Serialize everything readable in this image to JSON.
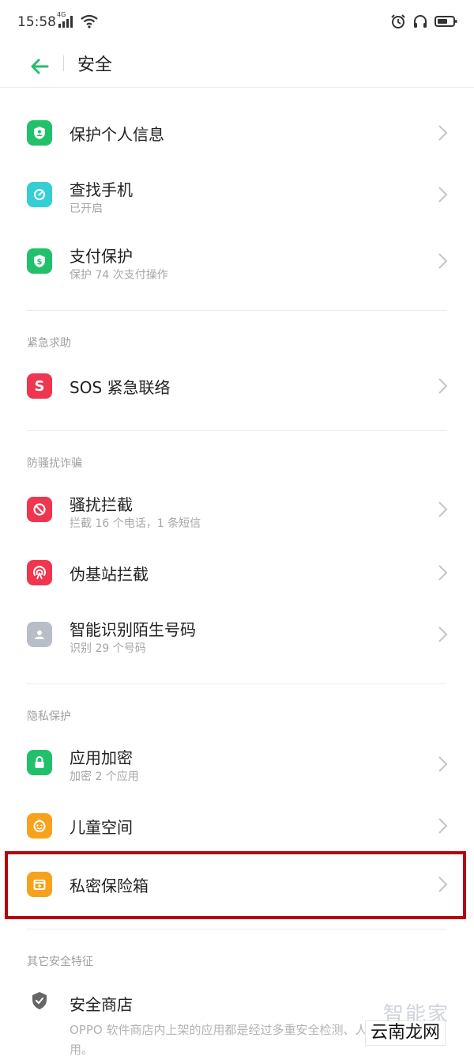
{
  "status_bar": {
    "time": "15:58",
    "network_label": "4G",
    "icons": [
      "signal-icon",
      "wifi-icon",
      "alarm-icon",
      "headset-icon",
      "battery-icon"
    ]
  },
  "nav": {
    "title": "安全",
    "back_icon": "back-arrow-icon"
  },
  "colors": {
    "accent_green": "#21c16b",
    "cyan": "#33cfd4",
    "red": "#f0354e",
    "grey": "#b7bec8",
    "orange": "#f7a21c",
    "highlight_red": "#b3050d"
  },
  "items": {
    "protect_info": {
      "title": "保护个人信息"
    },
    "find_phone": {
      "title": "查找手机",
      "subtitle": "已开启"
    },
    "payment": {
      "title": "支付保护",
      "subtitle": "保护 74 次支付操作"
    },
    "sos": {
      "title": "SOS 紧急联络",
      "icon_letter": "S"
    },
    "harass": {
      "title": "骚扰拦截",
      "subtitle": "拦截 16 个电话，1 条短信"
    },
    "pseudo_station": {
      "title": "伪基站拦截"
    },
    "identify": {
      "title": "智能识别陌生号码",
      "subtitle": "识别 29 个号码"
    },
    "app_lock": {
      "title": "应用加密",
      "subtitle": "加密 2 个应用"
    },
    "kids_space": {
      "title": "儿童空间"
    },
    "private_safe": {
      "title": "私密保险箱"
    },
    "security_store": {
      "title": "安全商店",
      "description": "OPPO 软件商店内上架的应用都是经过多重安全检测、人工审核的应用。"
    }
  },
  "sections": {
    "emergency": "紧急求助",
    "anti_fraud": "防骚扰诈骗",
    "privacy": "隐私保护",
    "other": "其它安全特征"
  },
  "watermark": {
    "top": "智能家",
    "box": "云南龙网"
  }
}
